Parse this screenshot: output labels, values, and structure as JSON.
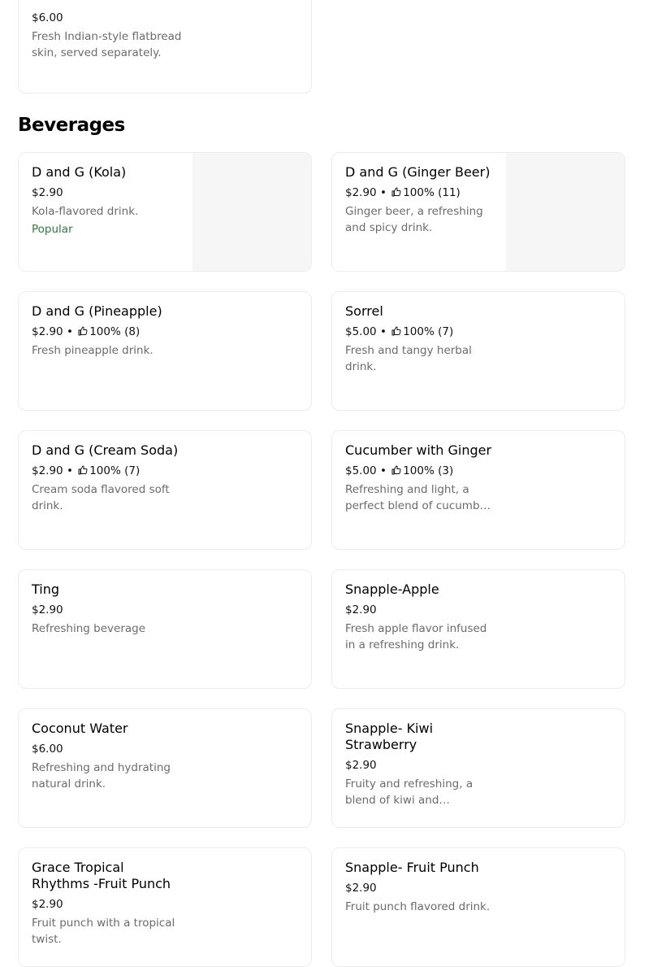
{
  "previous_item": {
    "price": "$6.00",
    "description": "Fresh Indian-style flatbread skin, served separately."
  },
  "section": {
    "title": "Beverages"
  },
  "items": [
    {
      "name": "D and G (Kola)",
      "price": "$2.90",
      "rating": "",
      "description": "Kola-flavored drink.",
      "tag": "Popular"
    },
    {
      "name": "D and G (Ginger Beer)",
      "price": "$2.90",
      "rating": "100% (11)",
      "description": "Ginger beer, a refreshing and spicy drink.",
      "tag": ""
    },
    {
      "name": "D and G (Pineapple)",
      "price": "$2.90",
      "rating": "100% (8)",
      "description": "Fresh pineapple drink.",
      "tag": ""
    },
    {
      "name": "Sorrel",
      "price": "$5.00",
      "rating": "100% (7)",
      "description": "Fresh and tangy herbal drink.",
      "tag": ""
    },
    {
      "name": "D and G (Cream Soda)",
      "price": "$2.90",
      "rating": "100% (7)",
      "description": "Cream soda flavored soft drink.",
      "tag": ""
    },
    {
      "name": "Cucumber with Ginger",
      "price": "$5.00",
      "rating": "100% (3)",
      "description": "Refreshing and light, a perfect blend of cucumber and ginger.",
      "tag": ""
    },
    {
      "name": "Ting",
      "price": "$2.90",
      "rating": "",
      "description": "Refreshing beverage",
      "tag": ""
    },
    {
      "name": "Snapple-Apple",
      "price": "$2.90",
      "rating": "",
      "description": "Fresh apple flavor infused in a refreshing drink.",
      "tag": ""
    },
    {
      "name": "Coconut Water",
      "price": "$6.00",
      "rating": "",
      "description": "Refreshing and hydrating natural drink.",
      "tag": ""
    },
    {
      "name": "Snapple- Kiwi Strawberry",
      "price": "$2.90",
      "rating": "",
      "description": "Fruity and refreshing, a blend of kiwi and strawberry.",
      "tag": ""
    },
    {
      "name": "Grace Tropical Rhythms -Fruit Punch",
      "price": "$2.90",
      "rating": "",
      "description": "Fruit punch with a tropical twist.",
      "tag": ""
    },
    {
      "name": "Snapple- Fruit Punch",
      "price": "$2.90",
      "rating": "",
      "description": "Fruit punch flavored drink.",
      "tag": ""
    }
  ],
  "colors": {
    "popular": "#2f7d3e",
    "description": "#6b6b6b",
    "border": "#ececec",
    "thumb_bg": "#f6f6f6"
  }
}
